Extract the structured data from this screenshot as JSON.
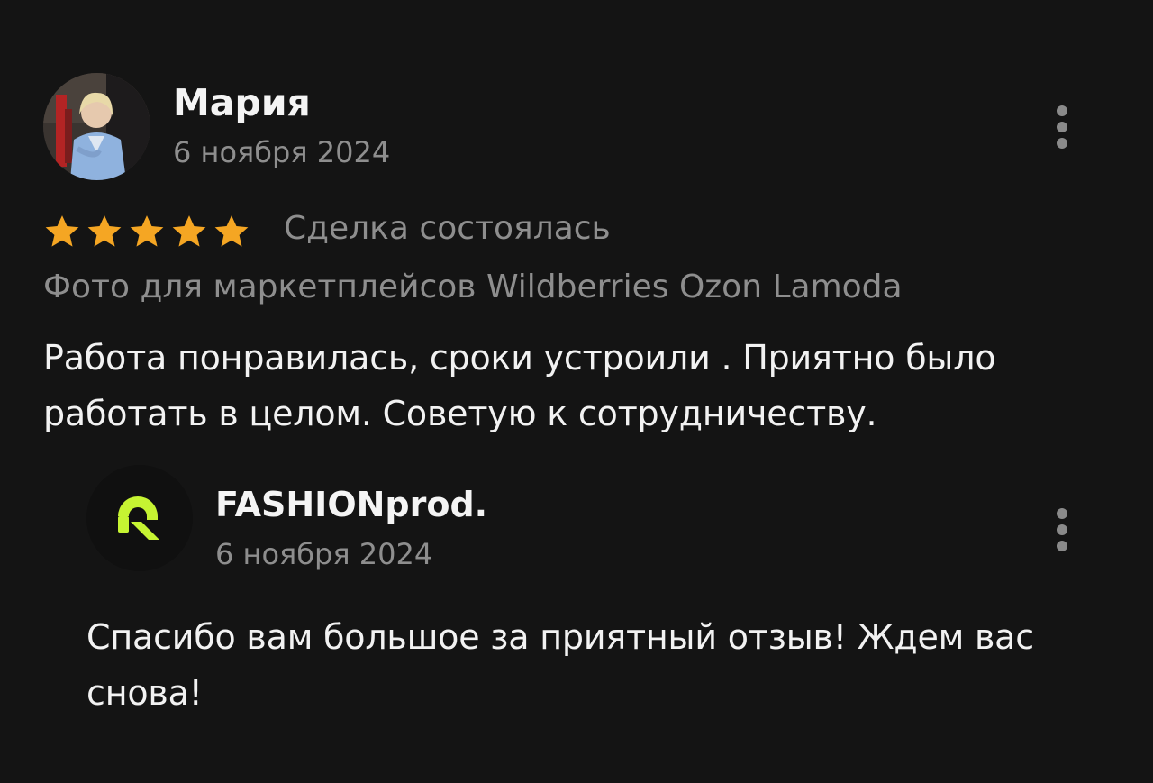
{
  "review": {
    "author": "Мария",
    "date": "6 ноября 2024",
    "rating": 5,
    "rating_max": 5,
    "deal_status": "Сделка состоялась",
    "service": "Фото для маркетплейсов Wildberries Ozon Lamoda",
    "text": "Работа понравилась, сроки устроили . Приятно было работать в целом. Советую к сотрудничеству.",
    "avatar_icon": "user-photo-avatar",
    "menu_icon": "more-vertical-icon"
  },
  "reply": {
    "author": "FASHIONprod.",
    "date": "6 ноября 2024",
    "text": "Спасибо вам большое за приятный отзыв! Ждем вас снова!",
    "logo_icon": "fashionprod-logo",
    "menu_icon": "more-vertical-icon"
  },
  "colors": {
    "background": "#141414",
    "text_primary": "#f2f2f2",
    "text_secondary": "#8e8e8e",
    "star": "#f5a623",
    "logo_accent": "#c6f432"
  }
}
